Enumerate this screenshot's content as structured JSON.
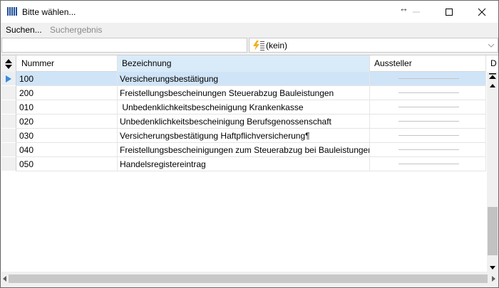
{
  "window": {
    "title": "Bitte wählen..."
  },
  "menu": {
    "search": "Suchen...",
    "result": "Suchergebnis"
  },
  "filter": {
    "search_value": "",
    "combo_value": "(kein)"
  },
  "grid": {
    "columns": [
      "Nummer",
      "Bezeichnung",
      "Aussteller",
      "D"
    ],
    "sorted_column": "Bezeichnung",
    "selected_row": 0,
    "rows": [
      {
        "nummer": "100",
        "bezeichnung": "Versicherungsbestätigung"
      },
      {
        "nummer": "200",
        "bezeichnung": "Freistellungsbescheinungen Steuerabzug Bauleistungen"
      },
      {
        "nummer": "010",
        "bezeichnung": " Unbedenklichkeitsbescheinigung Krankenkasse"
      },
      {
        "nummer": "020",
        "bezeichnung": "Unbedenklichkeitsbescheinigung Berufsgenossenschaft"
      },
      {
        "nummer": "030",
        "bezeichnung": "Versicherungsbestätigung Haftpflichversicherung¶"
      },
      {
        "nummer": "040",
        "bezeichnung": "Freistellungsbescheinigungen zum Steuerabzug bei Bauleistungen g"
      },
      {
        "nummer": "050",
        "bezeichnung": "Handelsregistereintrag"
      }
    ]
  },
  "colors": {
    "selection": "#cfe4f7",
    "sorted_header": "#d9ebf9",
    "row_pointer": "#3c8ad8"
  }
}
